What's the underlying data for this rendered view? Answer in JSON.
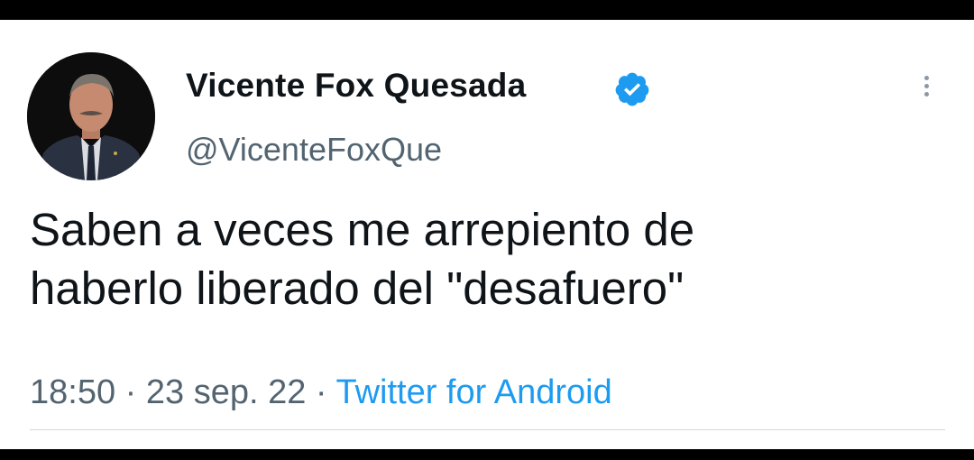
{
  "tweet": {
    "author": {
      "display_name": "Vicente Fox Quesada",
      "handle": "@VicenteFoxQue",
      "verified": true,
      "avatar_icon": "profile-photo"
    },
    "text_lines": [
      "Saben a veces me arrepiento de",
      "haberlo liberado del \"desafuero\""
    ],
    "time": "18:50",
    "separator": "·",
    "date": "23 sep. 22",
    "source": "Twitter for Android"
  },
  "colors": {
    "verified_badge": "#1d9bf0",
    "source_link": "#1d9bf0",
    "secondary_text": "#536471",
    "primary_text": "#0f1419"
  }
}
